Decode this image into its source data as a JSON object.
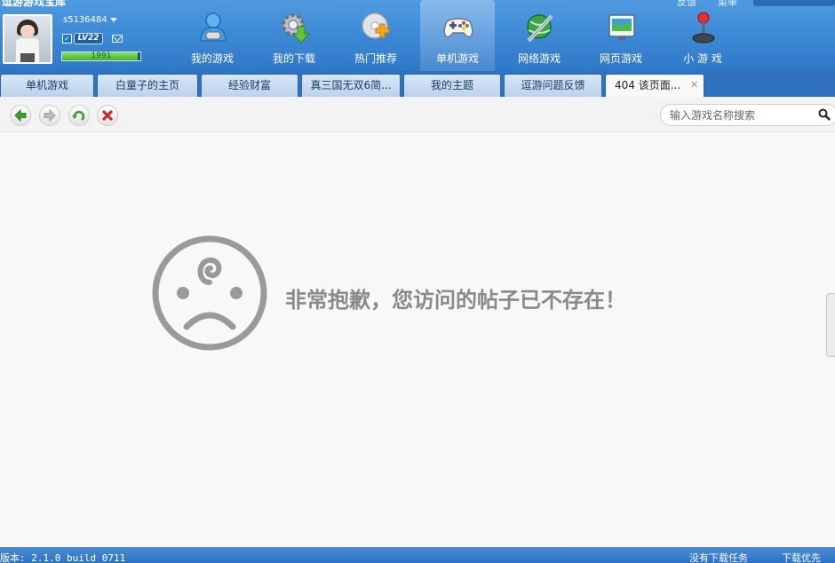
{
  "app": {
    "title": "逗游游戏宝库",
    "top_links": [
      "反馈",
      "菜单"
    ]
  },
  "user": {
    "name": "s5136484",
    "level": "LV22",
    "exp": "1991",
    "exp_progress": 0.97
  },
  "nav": {
    "items": [
      {
        "label": "我的游戏",
        "icon": "my-games-icon"
      },
      {
        "label": "我的下载",
        "icon": "download-gear-icon"
      },
      {
        "label": "热门推荐",
        "icon": "disc-plus-icon"
      },
      {
        "label": "单机游戏",
        "icon": "gamepad-icon",
        "active": true
      },
      {
        "label": "网络游戏",
        "icon": "globe-sword-icon"
      },
      {
        "label": "网页游戏",
        "icon": "web-screen-icon"
      },
      {
        "label": "小 游 戏",
        "icon": "joystick-icon"
      }
    ]
  },
  "tabs": [
    {
      "label": "单机游戏"
    },
    {
      "label": "白童子的主页"
    },
    {
      "label": "经验财富"
    },
    {
      "label": "真三国无双6简..."
    },
    {
      "label": "我的主题"
    },
    {
      "label": "逗游问题反馈"
    },
    {
      "label": "404 该页面...",
      "active": true,
      "closable": true
    }
  ],
  "toolbar": {
    "buttons": [
      "back-icon",
      "forward-icon",
      "refresh-icon",
      "stop-icon"
    ],
    "search_placeholder": "输入游戏名称搜索"
  },
  "content": {
    "error_message": "非常抱歉，您访问的帖子已不存在！"
  },
  "statusbar": {
    "version": "版本: 2.1.0 build 0711",
    "download_status": "没有下载任务",
    "download_priority": "下载优先"
  },
  "colors": {
    "header_blue": "#3c87d4",
    "tab_blue": "#3072c0",
    "error_gray": "#8a8a8a"
  }
}
